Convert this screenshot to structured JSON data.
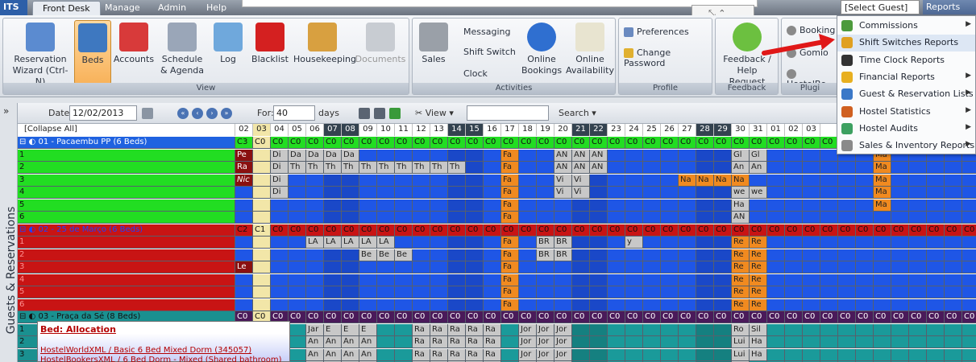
{
  "titlebar": {
    "logo": "ITS",
    "tabs": [
      "Front Desk",
      "Manage",
      "Admin",
      "Help"
    ],
    "select_guest": "[Select Guest]",
    "reports": "Reports",
    "minibar": "⤡ ⌃"
  },
  "ribbon": {
    "view_group": {
      "label": "View",
      "buttons": [
        {
          "label": "Reservation\nWizard (Ctrl-N)",
          "icon": "person-add-icon"
        },
        {
          "label": "Beds",
          "icon": "bed-icon",
          "active": true
        },
        {
          "label": "Accounts",
          "icon": "binders-icon"
        },
        {
          "label": "Schedule\n& Agenda",
          "icon": "calendar-icon"
        },
        {
          "label": "Log",
          "icon": "notepad-icon"
        },
        {
          "label": "Blacklist",
          "icon": "flag-icon"
        },
        {
          "label": "Housekeeping",
          "icon": "broom-icon"
        },
        {
          "label": "Documents",
          "icon": "documents-icon"
        }
      ]
    },
    "activities_group": {
      "label": "Activities",
      "sales": "Sales",
      "messaging": "Messaging",
      "shift_switch": "Shift Switch",
      "clock": "Clock",
      "online_bookings": "Online\nBookings",
      "online_availability": "Online\nAvailability"
    },
    "profile_group": {
      "label": "Profile",
      "preferences": "Preferences",
      "change_password": "Change Password"
    },
    "feedback_group": {
      "label": "Feedback",
      "feedback": "Feedback /\nHelp Request"
    },
    "plugins_group": {
      "label": "Plugi",
      "items": [
        "Booking",
        "Gomio",
        "HostelBo"
      ]
    }
  },
  "dropdown_menu": [
    {
      "label": "Commissions",
      "icon": "commissions-icon",
      "submenu": true,
      "color": "#4c9a3c"
    },
    {
      "label": "Shift Switches Reports",
      "icon": "shift-switch-icon",
      "submenu": false,
      "color": "#e0a020"
    },
    {
      "label": "Time Clock Reports",
      "icon": "clock-icon",
      "submenu": false,
      "color": "#333333"
    },
    {
      "label": "Financial Reports",
      "icon": "financial-icon",
      "submenu": true,
      "color": "#e8b020"
    },
    {
      "label": "Guest & Reservation Lists",
      "icon": "guest-list-icon",
      "submenu": true,
      "color": "#3a78c8"
    },
    {
      "label": "Hostel Statistics",
      "icon": "statistics-icon",
      "submenu": true,
      "color": "#d06020"
    },
    {
      "label": "Hostel Audits",
      "icon": "audits-icon",
      "submenu": true,
      "color": "#3ca060"
    },
    {
      "label": "Sales & Inventory Reports",
      "icon": "cart-icon",
      "submenu": true,
      "color": "#8a8a8a"
    }
  ],
  "side_panel": {
    "label": "Guests & Reservations"
  },
  "toolbar": {
    "date_label": "Date:",
    "date_value": "12/02/2013",
    "for_label": "For:",
    "for_value": "40",
    "days_label": "days",
    "view_label": "View",
    "search_label": "Search"
  },
  "grid": {
    "collapse_label": "[Collapse All]",
    "days": [
      "02",
      "03",
      "04",
      "05",
      "06",
      "07",
      "08",
      "09",
      "10",
      "11",
      "12",
      "13",
      "14",
      "15",
      "16",
      "17",
      "18",
      "19",
      "20",
      "21",
      "22",
      "23",
      "24",
      "25",
      "26",
      "27",
      "28",
      "29",
      "30",
      "31",
      "01",
      "02",
      "03"
    ],
    "weekend_days": [
      5,
      6,
      12,
      13,
      19,
      20,
      26,
      27
    ],
    "rooms": [
      {
        "name": "01 - Pacaembu PP (6 Beds)",
        "color": "#22dd22",
        "header_color": "#1f62e0",
        "header_text": "#ffffff",
        "codes": [
          "C3",
          "C0"
        ],
        "beds": [
          {
            "n": "1",
            "cells": {
              "0": "Pe",
              "2": "Di",
              "3": "Da",
              "4": "Da",
              "5": "Da",
              "6": "Da",
              "15": "Fa",
              "18": "AN",
              "19": "AN",
              "20": "AN",
              "28": "Gl",
              "29": "Gl",
              "36": "Ma"
            }
          },
          {
            "n": "2",
            "cells": {
              "0": "Ra",
              "2": "Di",
              "3": "Th",
              "4": "Th",
              "5": "Th",
              "6": "Th",
              "7": "Th",
              "8": "Th",
              "9": "Th",
              "10": "Th",
              "11": "Th",
              "12": "Th",
              "15": "Fa",
              "18": "AN",
              "19": "AN",
              "20": "AN",
              "28": "An",
              "29": "An",
              "36": "Ma"
            }
          },
          {
            "n": "3",
            "cells": {
              "0": "Nic",
              "2": "Di",
              "15": "Fa",
              "18": "Vi",
              "19": "Vi",
              "25": "Na",
              "26": "Na",
              "27": "Na",
              "28": "Na",
              "36": "Ma"
            }
          },
          {
            "n": "4",
            "cells": {
              "2": "Di",
              "15": "Fa",
              "18": "Vi",
              "19": "Vi",
              "28": "we",
              "29": "we",
              "36": "Ma"
            }
          },
          {
            "n": "5",
            "cells": {
              "15": "Fa",
              "28": "Ha",
              "36": "Ma"
            }
          },
          {
            "n": "6",
            "cells": {
              "15": "Fa",
              "28": "AN"
            }
          }
        ]
      },
      {
        "name": "02 - 25 de Março (6 Beds)",
        "color": "#c81414",
        "header_color": "#c81414",
        "header_text": "#2040ff",
        "codes": [
          "C2",
          "C1"
        ],
        "beds": [
          {
            "n": "1",
            "cells": {
              "4": "LA",
              "5": "LA",
              "6": "LA",
              "7": "LA",
              "8": "LA",
              "15": "Fa",
              "17": "BR",
              "18": "BR",
              "22": "y",
              "28": "Re",
              "29": "Re"
            }
          },
          {
            "n": "2",
            "cells": {
              "7": "Be",
              "8": "Be",
              "9": "Be",
              "15": "Fa",
              "17": "BR",
              "18": "BR",
              "28": "Re",
              "29": "Re"
            }
          },
          {
            "n": "3",
            "cells": {
              "0": "Le",
              "15": "Fa",
              "28": "Re",
              "29": "Re"
            }
          },
          {
            "n": "4",
            "cells": {
              "15": "Fa",
              "28": "Re",
              "29": "Re"
            }
          },
          {
            "n": "5",
            "cells": {
              "15": "Fa",
              "28": "Re",
              "29": "Re"
            }
          },
          {
            "n": "6",
            "cells": {
              "15": "Fa",
              "28": "Re",
              "29": "Re"
            }
          }
        ]
      },
      {
        "name": "03 - Praça da Sé (8 Beds)",
        "color": "#1a9090",
        "header_color": "#1a9090",
        "header_text": "#111111",
        "codes": [
          "C0",
          "C0"
        ],
        "beds": [
          {
            "n": "1",
            "cells": {
              "1": "Br",
              "2": "Br",
              "4": "Jar",
              "5": "E",
              "6": "E",
              "7": "E",
              "10": "Ra",
              "11": "Ra",
              "12": "Ra",
              "13": "Ra",
              "14": "Ra",
              "16": "Jor",
              "17": "Jor",
              "18": "Jor",
              "28": "Ro",
              "29": "Sil"
            }
          },
          {
            "n": "2",
            "cells": {
              "4": "An",
              "5": "An",
              "6": "An",
              "7": "An",
              "10": "Ra",
              "11": "Ra",
              "12": "Ra",
              "13": "Ra",
              "14": "Ra",
              "16": "Jor",
              "17": "Jor",
              "18": "Jor",
              "28": "Lui",
              "29": "Ha"
            }
          },
          {
            "n": "3",
            "cells": {
              "4": "An",
              "5": "An",
              "6": "An",
              "7": "An",
              "10": "Ra",
              "11": "Ra",
              "12": "Ra",
              "13": "Ra",
              "14": "Ra",
              "16": "Jor",
              "17": "Jor",
              "18": "Jor",
              "28": "Lui",
              "29": "Ha"
            }
          },
          {
            "n": "4",
            "cells": {
              "4": "An",
              "5": "An",
              "6": "An",
              "7": "An",
              "10": "Ra",
              "11": "Ra",
              "12": "Ra",
              "13": "Ra",
              "14": "Ra",
              "16": "Jor",
              "17": "Jor",
              "18": "Jor",
              "28": "Wil"
            }
          }
        ]
      }
    ]
  },
  "alloc_popup": {
    "title": "Bed: Allocation",
    "line1": "HostelWorldXML / Basic 6 Bed Mixed Dorm (345057)",
    "line2": "HostelBookersXML / 6 Bed Dorm - Mixed (Shared bathroom)"
  }
}
